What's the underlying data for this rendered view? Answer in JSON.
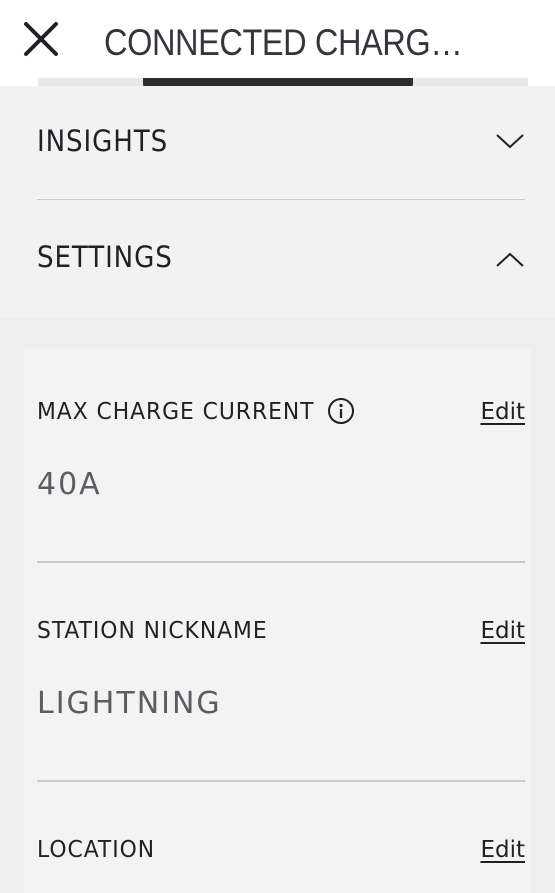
{
  "header": {
    "title": "CONNECTED CHARGE S..."
  },
  "accordion": {
    "insights_label": "INSIGHTS",
    "settings_label": "SETTINGS"
  },
  "settings": {
    "max_charge_current": {
      "label": "MAX CHARGE CURRENT",
      "value": "40A",
      "edit_label": "Edit"
    },
    "station_nickname": {
      "label": "STATION NICKNAME",
      "value": "LIGHTNING",
      "edit_label": "Edit"
    },
    "location": {
      "label": "LOCATION",
      "edit_label": "Edit"
    }
  },
  "icons": {
    "close": "close-icon",
    "insights_chevron": "chevron-down-icon",
    "settings_chevron": "chevron-up-icon",
    "info": "info-icon"
  }
}
